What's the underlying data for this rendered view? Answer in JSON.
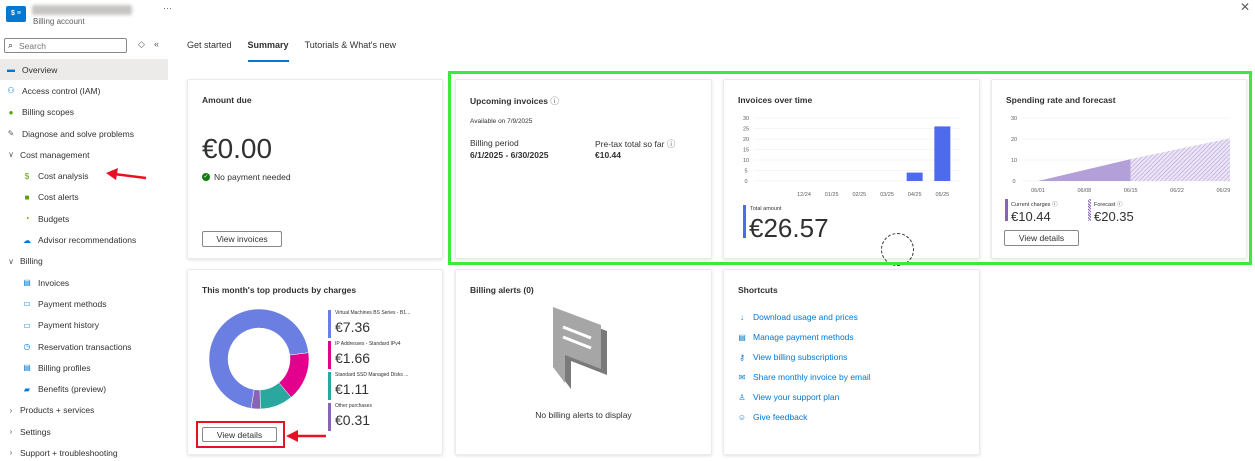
{
  "brand": {
    "logo_text": "$ ≡",
    "subtitle": "Billing account",
    "more": "···"
  },
  "search": {
    "placeholder": "Search",
    "ctl1": "◇",
    "ctl2": "«"
  },
  "nav": [
    {
      "label": "Overview",
      "icon": "overview-icon",
      "glyph": "▬",
      "color": "#0078d4",
      "sub": false,
      "active": true
    },
    {
      "label": "Access control (IAM)",
      "icon": "people-icon",
      "glyph": "⚇",
      "color": "#0078d4",
      "sub": false
    },
    {
      "label": "Billing scopes",
      "icon": "billing-scope-icon",
      "glyph": "●",
      "color": "#57a300",
      "sub": false
    },
    {
      "label": "Diagnose and solve problems",
      "icon": "wrench-icon",
      "glyph": "✎",
      "color": "#605e5c",
      "sub": false
    },
    {
      "label": "Cost management",
      "icon": "chevron-down-icon",
      "glyph": "∨",
      "color": "#605e5c",
      "sub": false,
      "chev": true
    },
    {
      "label": "Cost analysis",
      "icon": "dollar-icon",
      "glyph": "$",
      "color": "#57a300",
      "sub": true
    },
    {
      "label": "Cost alerts",
      "icon": "alert-icon",
      "glyph": "■",
      "color": "#57a300",
      "sub": true
    },
    {
      "label": "Budgets",
      "icon": "budget-icon",
      "glyph": "◔",
      "color": "#57a300",
      "sub": true
    },
    {
      "label": "Advisor recommendations",
      "icon": "advisor-icon",
      "glyph": "☁",
      "color": "#0078d4",
      "sub": true
    },
    {
      "label": "Billing",
      "icon": "chevron-down-icon",
      "glyph": "∨",
      "color": "#605e5c",
      "sub": false,
      "chev": true
    },
    {
      "label": "Invoices",
      "icon": "invoice-icon",
      "glyph": "▤",
      "color": "#0078d4",
      "sub": true
    },
    {
      "label": "Payment methods",
      "icon": "card-icon",
      "glyph": "▭",
      "color": "#0078d4",
      "sub": true
    },
    {
      "label": "Payment history",
      "icon": "history-icon",
      "glyph": "▭",
      "color": "#0078d4",
      "sub": true
    },
    {
      "label": "Reservation transactions",
      "icon": "clock-icon",
      "glyph": "◷",
      "color": "#0078d4",
      "sub": true
    },
    {
      "label": "Billing profiles",
      "icon": "profile-icon",
      "glyph": "▤",
      "color": "#0078d4",
      "sub": true
    },
    {
      "label": "Benefits (preview)",
      "icon": "benefits-icon",
      "glyph": "▰",
      "color": "#0078d4",
      "sub": true
    },
    {
      "label": "Products + services",
      "icon": "chevron-right-icon",
      "glyph": "›",
      "color": "#605e5c",
      "sub": false,
      "chev": true
    },
    {
      "label": "Settings",
      "icon": "chevron-right-icon",
      "glyph": "›",
      "color": "#605e5c",
      "sub": false,
      "chev": true
    },
    {
      "label": "Support + troubleshooting",
      "icon": "chevron-right-icon",
      "glyph": "›",
      "color": "#605e5c",
      "sub": false,
      "chev": true
    }
  ],
  "tabs": [
    "Get started",
    "Summary",
    "Tutorials & What's new"
  ],
  "amount_due": {
    "title": "Amount due",
    "amount": "€0.00",
    "status": "No payment needed",
    "button": "View invoices"
  },
  "upcoming": {
    "title": "Upcoming invoices",
    "available": "Available on 7/9/2025",
    "period_label": "Billing period",
    "period_value": "6/1/2025 - 6/30/2025",
    "pretax_label": "Pre-tax total so far",
    "pretax_value": "€10.44"
  },
  "invoices_time": {
    "title": "Invoices over time",
    "total_label": "Total amount",
    "total_value": "€26.57"
  },
  "spending": {
    "title": "Spending rate and forecast",
    "current_label": "Current charges",
    "current_value": "€10.44",
    "forecast_label": "Forecast",
    "forecast_value": "€20.35",
    "button": "View details"
  },
  "top_products": {
    "title": "This month's top products by charges",
    "button": "View details",
    "items": [
      {
        "name": "Virtual Machines BS Series - B1...",
        "value": "€7.36",
        "color": "#6b7fe3"
      },
      {
        "name": "IP Addresses - Standard IPv4",
        "value": "€1.66",
        "color": "#e3008c"
      },
      {
        "name": "Standard SSD Managed Disks ...",
        "value": "€1.11",
        "color": "#2aa8a0"
      },
      {
        "name": "Other purchases",
        "value": "€0.31",
        "color": "#8764b8"
      }
    ]
  },
  "billing_alerts": {
    "title": "Billing alerts (0)",
    "empty": "No billing alerts to display"
  },
  "shortcuts": {
    "title": "Shortcuts",
    "items": [
      {
        "label": "Download usage and prices",
        "icon": "download-icon",
        "glyph": "↓"
      },
      {
        "label": "Manage payment methods",
        "icon": "card-icon",
        "glyph": "▤"
      },
      {
        "label": "View billing subscriptions",
        "icon": "key-icon",
        "glyph": "⚷"
      },
      {
        "label": "Share monthly invoice by email",
        "icon": "mail-icon",
        "glyph": "✉"
      },
      {
        "label": "View your support plan",
        "icon": "person-icon",
        "glyph": "♙"
      },
      {
        "label": "Give feedback",
        "icon": "feedback-icon",
        "glyph": "☺"
      }
    ]
  },
  "chart_data": [
    {
      "type": "bar",
      "categories": [
        "12/24",
        "01/25",
        "02/25",
        "03/25",
        "04/25",
        "05/25"
      ],
      "values": [
        0,
        0,
        0,
        0,
        4,
        26
      ],
      "ylim": [
        0,
        30
      ],
      "yticks": [
        "30",
        "25",
        "20",
        "15",
        "10",
        "5",
        "0"
      ],
      "grid": true,
      "color": "#4f6bed"
    },
    {
      "type": "area",
      "x": [
        "06/01",
        "06/08",
        "06/15",
        "06/22",
        "06/29"
      ],
      "series": [
        {
          "x": [
            "06/01",
            "06/15"
          ],
          "values": [
            0,
            10.44
          ],
          "color": "#b4a0d8"
        },
        {
          "x": [
            "06/15",
            "06/30"
          ],
          "values": [
            10.44,
            20.35
          ],
          "color": "#d9cdef",
          "hatched": true
        }
      ],
      "ylim": [
        0,
        30
      ],
      "yticks": [
        "30",
        "20",
        "10",
        "0"
      ],
      "grid": true
    },
    {
      "type": "pie",
      "donut": true,
      "labels": [
        "Virtual Machines BS Series - B1...",
        "IP Addresses - Standard IPv4",
        "Standard SSD Managed Disks ...",
        "Other purchases"
      ],
      "values": [
        7.36,
        1.66,
        1.11,
        0.31
      ],
      "colors": [
        "#6b7fe3",
        "#e3008c",
        "#2aa8a0",
        "#8764b8"
      ]
    }
  ]
}
